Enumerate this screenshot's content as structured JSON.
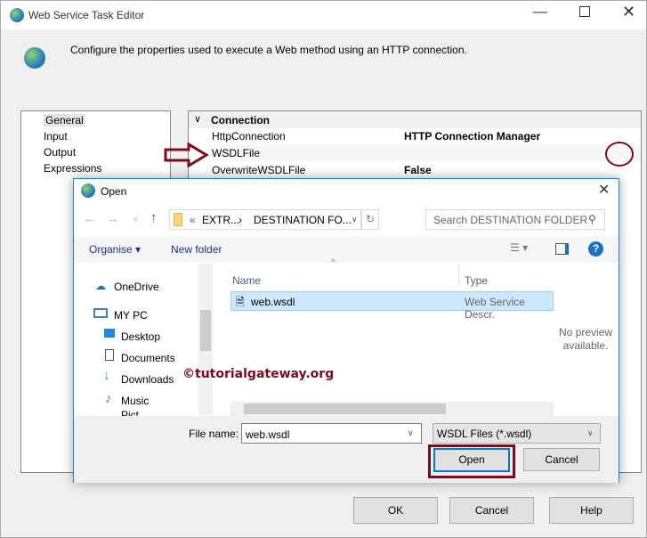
{
  "window": {
    "title": "Web Service Task Editor",
    "description": "Configure the properties used to execute a Web method using an HTTP connection."
  },
  "sidebar": {
    "items": [
      {
        "label": "General"
      },
      {
        "label": "Input"
      },
      {
        "label": "Output"
      },
      {
        "label": "Expressions"
      }
    ]
  },
  "properties": {
    "section": "Connection",
    "rows": [
      {
        "name": "HttpConnection",
        "value": "HTTP Connection Manager"
      },
      {
        "name": "WSDLFile",
        "value": ""
      },
      {
        "name": "OverwriteWSDLFile",
        "value": "False"
      }
    ]
  },
  "footer": {
    "ok": "OK",
    "cancel": "Cancel",
    "help": "Help"
  },
  "dialog": {
    "title": "Open",
    "breadcrumb": {
      "prefix": "«",
      "part1": "EXTR...",
      "sep": "›",
      "part2": "DESTINATION FO..."
    },
    "search_placeholder": "Search DESTINATION FOLDER",
    "toolbar": {
      "organise": "Organise ▾",
      "new_folder": "New folder"
    },
    "nav": [
      {
        "label": "OneDrive"
      },
      {
        "label": "MY PC"
      },
      {
        "label": "Desktop"
      },
      {
        "label": "Documents"
      },
      {
        "label": "Downloads"
      },
      {
        "label": "Music"
      },
      {
        "label": "Pict"
      }
    ],
    "columns": {
      "name": "Name",
      "type": "Type"
    },
    "files": [
      {
        "name": "web.wsdl",
        "type": "Web Service Descr."
      }
    ],
    "preview": "No preview available.",
    "filename_label": "File name:",
    "filename_value": "web.wsdl",
    "filter": "WSDL Files (*.wsdl)",
    "open": "Open",
    "cancel": "Cancel"
  },
  "watermark": "©tutorialgateway.org",
  "colors": {
    "annotation": "#7b0c1e",
    "accent": "#0078d7"
  }
}
